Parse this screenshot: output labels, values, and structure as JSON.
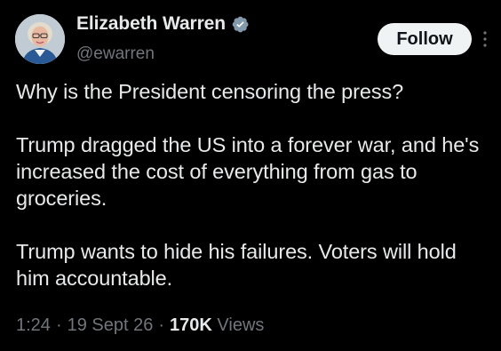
{
  "author": {
    "display_name": "Elizabeth Warren",
    "handle": "@ewarren",
    "verified_icon": "verified-badge-icon",
    "avatar_icon": "profile-photo"
  },
  "follow_button": {
    "label": "Follow"
  },
  "more_menu_icon": "more-vertical-icon",
  "tweet": {
    "paragraphs": [
      "Why is the President censoring the press?",
      "Trump dragged the US into a forever war, and he's increased the cost of everything from gas to groceries.",
      "Trump wants to hide his failures. Voters will hold him accountable."
    ]
  },
  "meta": {
    "time": "1:24",
    "separator": "·",
    "date": "19 Sept 26",
    "views_count": "170K",
    "views_label": "Views"
  },
  "colors": {
    "background": "#000000",
    "text_primary": "#e7e9ea",
    "text_secondary": "#71767b",
    "verified_blue": "#829aab",
    "follow_bg": "#eff3f4"
  }
}
